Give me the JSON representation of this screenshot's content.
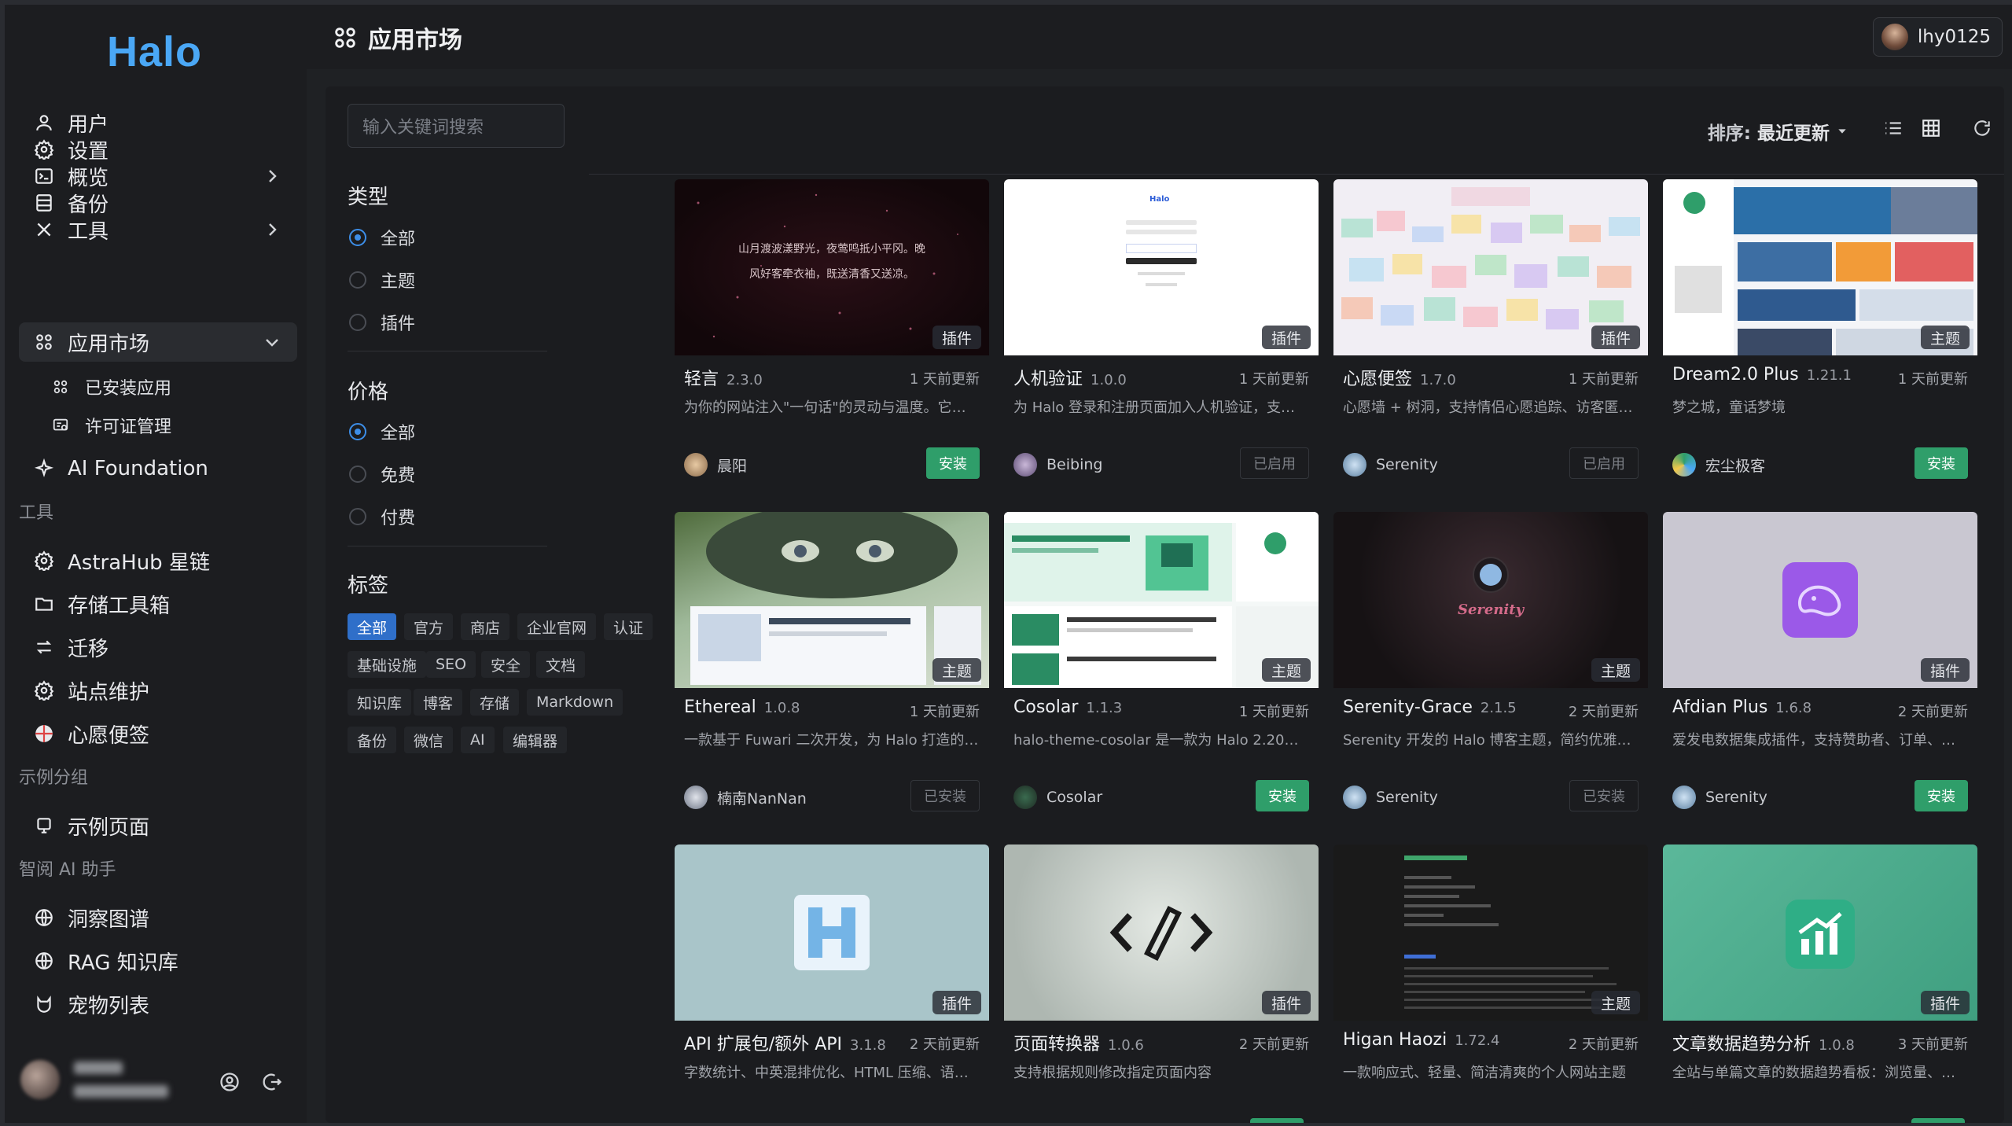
{
  "app": {
    "logo": "Halo"
  },
  "sidebar": {
    "items": [
      {
        "label": "用户",
        "icon": "user-icon"
      },
      {
        "label": "设置",
        "icon": "gear-icon"
      },
      {
        "label": "概览",
        "icon": "terminal-icon"
      },
      {
        "label": "备份",
        "icon": "database-icon"
      },
      {
        "label": "工具",
        "icon": "tools-icon"
      },
      {
        "label": "应用市场",
        "icon": "apps-icon"
      },
      {
        "label": "AI Foundation",
        "icon": "sparkle-icon"
      }
    ],
    "sub_items": [
      {
        "label": "已安装应用"
      },
      {
        "label": "许可证管理"
      }
    ],
    "group_tools": "工具",
    "tool_items": [
      {
        "label": "AstraHub 星链"
      },
      {
        "label": "存储工具箱"
      },
      {
        "label": "迁移"
      },
      {
        "label": "站点维护"
      },
      {
        "label": "心愿便签"
      }
    ],
    "group_example": "示例分组",
    "example_items": [
      {
        "label": "示例页面"
      }
    ],
    "group_ai": "智阅 AI 助手",
    "ai_items": [
      {
        "label": "洞察图谱"
      },
      {
        "label": "RAG 知识库"
      },
      {
        "label": "宠物列表"
      }
    ]
  },
  "header": {
    "title": "应用市场",
    "username": "lhy0125"
  },
  "search": {
    "placeholder": "输入关键词搜索"
  },
  "toolbar": {
    "sort_key": "排序:",
    "sort_value": "最近更新"
  },
  "filters": {
    "type_title": "类型",
    "type_options": [
      "全部",
      "主题",
      "插件"
    ],
    "price_title": "价格",
    "price_options": [
      "全部",
      "免费",
      "付费"
    ],
    "tag_title": "标签",
    "tags": [
      "全部",
      "官方",
      "商店",
      "企业官网",
      "认证",
      "基础设施",
      "SEO",
      "安全",
      "文档",
      "知识库",
      "博客",
      "存储",
      "Markdown",
      "备份",
      "微信",
      "AI",
      "编辑器"
    ]
  },
  "cards": [
    {
      "name": "轻言",
      "version": "2.3.0",
      "time": "1 天前更新",
      "desc": "为你的网站注入\"一句话\"的灵动与温度。它支…",
      "author": "晨阳",
      "type": "插件",
      "button": "安装",
      "thumb_text1": "山月渡波漾野光，夜莺鸣抵小平冈。晚",
      "thumb_text2": "风好客牵衣袖，既送清香又送凉。"
    },
    {
      "name": "人机验证",
      "version": "1.0.0",
      "time": "1 天前更新",
      "desc": "为 Halo 登录和注册页面加入人机验证，支持…",
      "author": "Beibing",
      "type": "插件",
      "button": "已启用",
      "thumb_text1": "Halo"
    },
    {
      "name": "心愿便签",
      "version": "1.7.0",
      "time": "1 天前更新",
      "desc": "心愿墙 + 树洞，支持情侣心愿追踪、访客匿…",
      "author": "Serenity",
      "type": "插件",
      "button": "已启用"
    },
    {
      "name": "Dream2.0 Plus",
      "version": "1.21.1",
      "time": "1 天前更新",
      "desc": "梦之城，童话梦境",
      "author": "宏尘极客",
      "type": "主题",
      "button": "安装"
    },
    {
      "name": "Ethereal",
      "version": "1.0.8",
      "time": "1 天前更新",
      "desc": "一款基于 Fuwari 二次开发，为 Halo 打造的…",
      "author": "楠南NanNan",
      "type": "主题",
      "button": "已安装"
    },
    {
      "name": "Cosolar",
      "version": "1.1.3",
      "time": "1 天前更新",
      "desc": "halo-theme-cosolar 是一款为 Halo 2.20+ …",
      "author": "Cosolar",
      "type": "主题",
      "button": "安装"
    },
    {
      "name": "Serenity-Grace",
      "version": "2.1.5",
      "time": "2 天前更新",
      "desc": "Serenity 开发的 Halo 博客主题，简约优雅，…",
      "author": "Serenity",
      "type": "主题",
      "button": "已安装",
      "thumb_text1": "Serenity"
    },
    {
      "name": "Afdian Plus",
      "version": "1.6.8",
      "time": "2 天前更新",
      "desc": "爱发电数据集成插件，支持赞助者、订单、方…",
      "author": "Serenity",
      "type": "插件",
      "button": "安装"
    },
    {
      "name": "API 扩展包/额外 API",
      "version": "3.1.8",
      "time": "2 天前更新",
      "desc": "字数统计、中英混排优化、HTML 压缩、语…",
      "author": "",
      "type": "插件",
      "button": ""
    },
    {
      "name": "页面转换器",
      "version": "1.0.6",
      "time": "2 天前更新",
      "desc": "支持根据规则修改指定页面内容",
      "author": "",
      "type": "插件",
      "button": ""
    },
    {
      "name": "Higan Haozi",
      "version": "1.72.4",
      "time": "2 天前更新",
      "desc": "一款响应式、轻量、简洁清爽的个人网站主题",
      "author": "",
      "type": "主题",
      "button": ""
    },
    {
      "name": "文章数据趋势分析",
      "version": "1.0.8",
      "time": "3 天前更新",
      "desc": "全站与单篇文章的数据趋势看板：浏览量、访…",
      "author": "",
      "type": "插件",
      "button": ""
    }
  ],
  "colors": {
    "accent": "#3d8ee8",
    "install": "#2f9e6a",
    "logo": "#4aa7f5"
  }
}
